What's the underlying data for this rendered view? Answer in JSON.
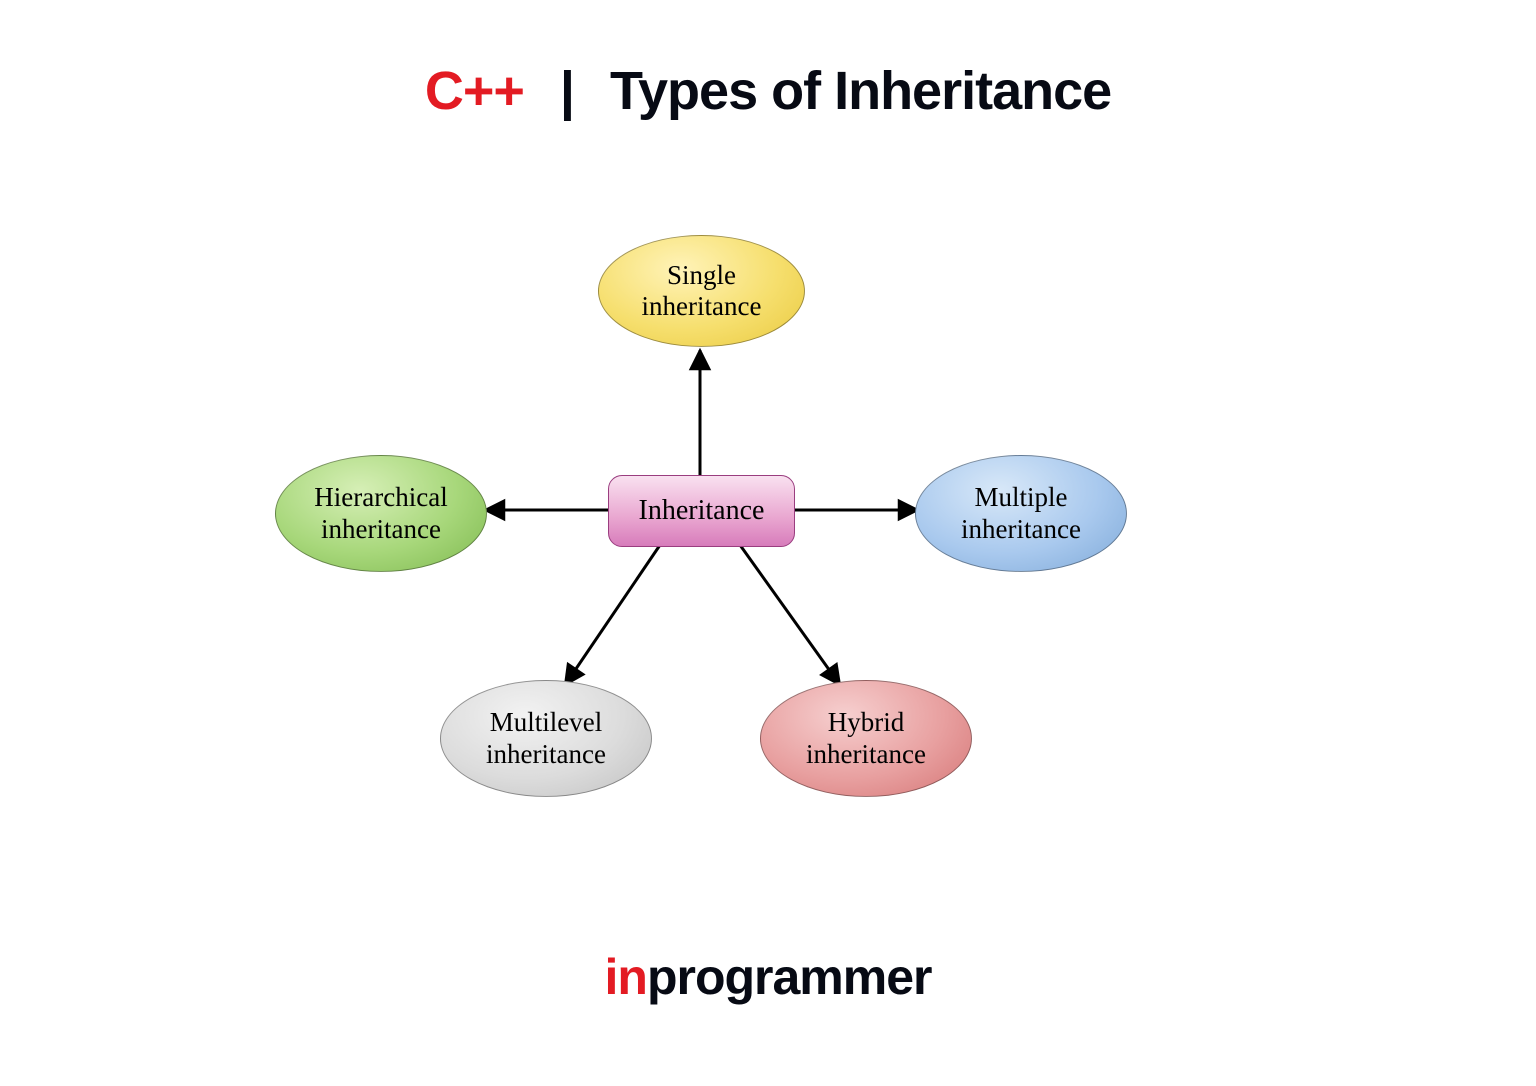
{
  "title": {
    "prefix": "C++",
    "separator": "|",
    "text": "Types of Inheritance"
  },
  "diagram": {
    "center": {
      "label": "Inheritance"
    },
    "nodes": {
      "top": {
        "line1": "Single",
        "line2": "inheritance"
      },
      "left": {
        "line1": "Hierarchical",
        "line2": "inheritance"
      },
      "right": {
        "line1": "Multiple",
        "line2": "inheritance"
      },
      "bottomLeft": {
        "line1": "Multilevel",
        "line2": "inheritance"
      },
      "bottomRight": {
        "line1": "Hybrid",
        "line2": "inheritance"
      }
    }
  },
  "footer": {
    "prefix": "in",
    "rest": "programmer"
  }
}
